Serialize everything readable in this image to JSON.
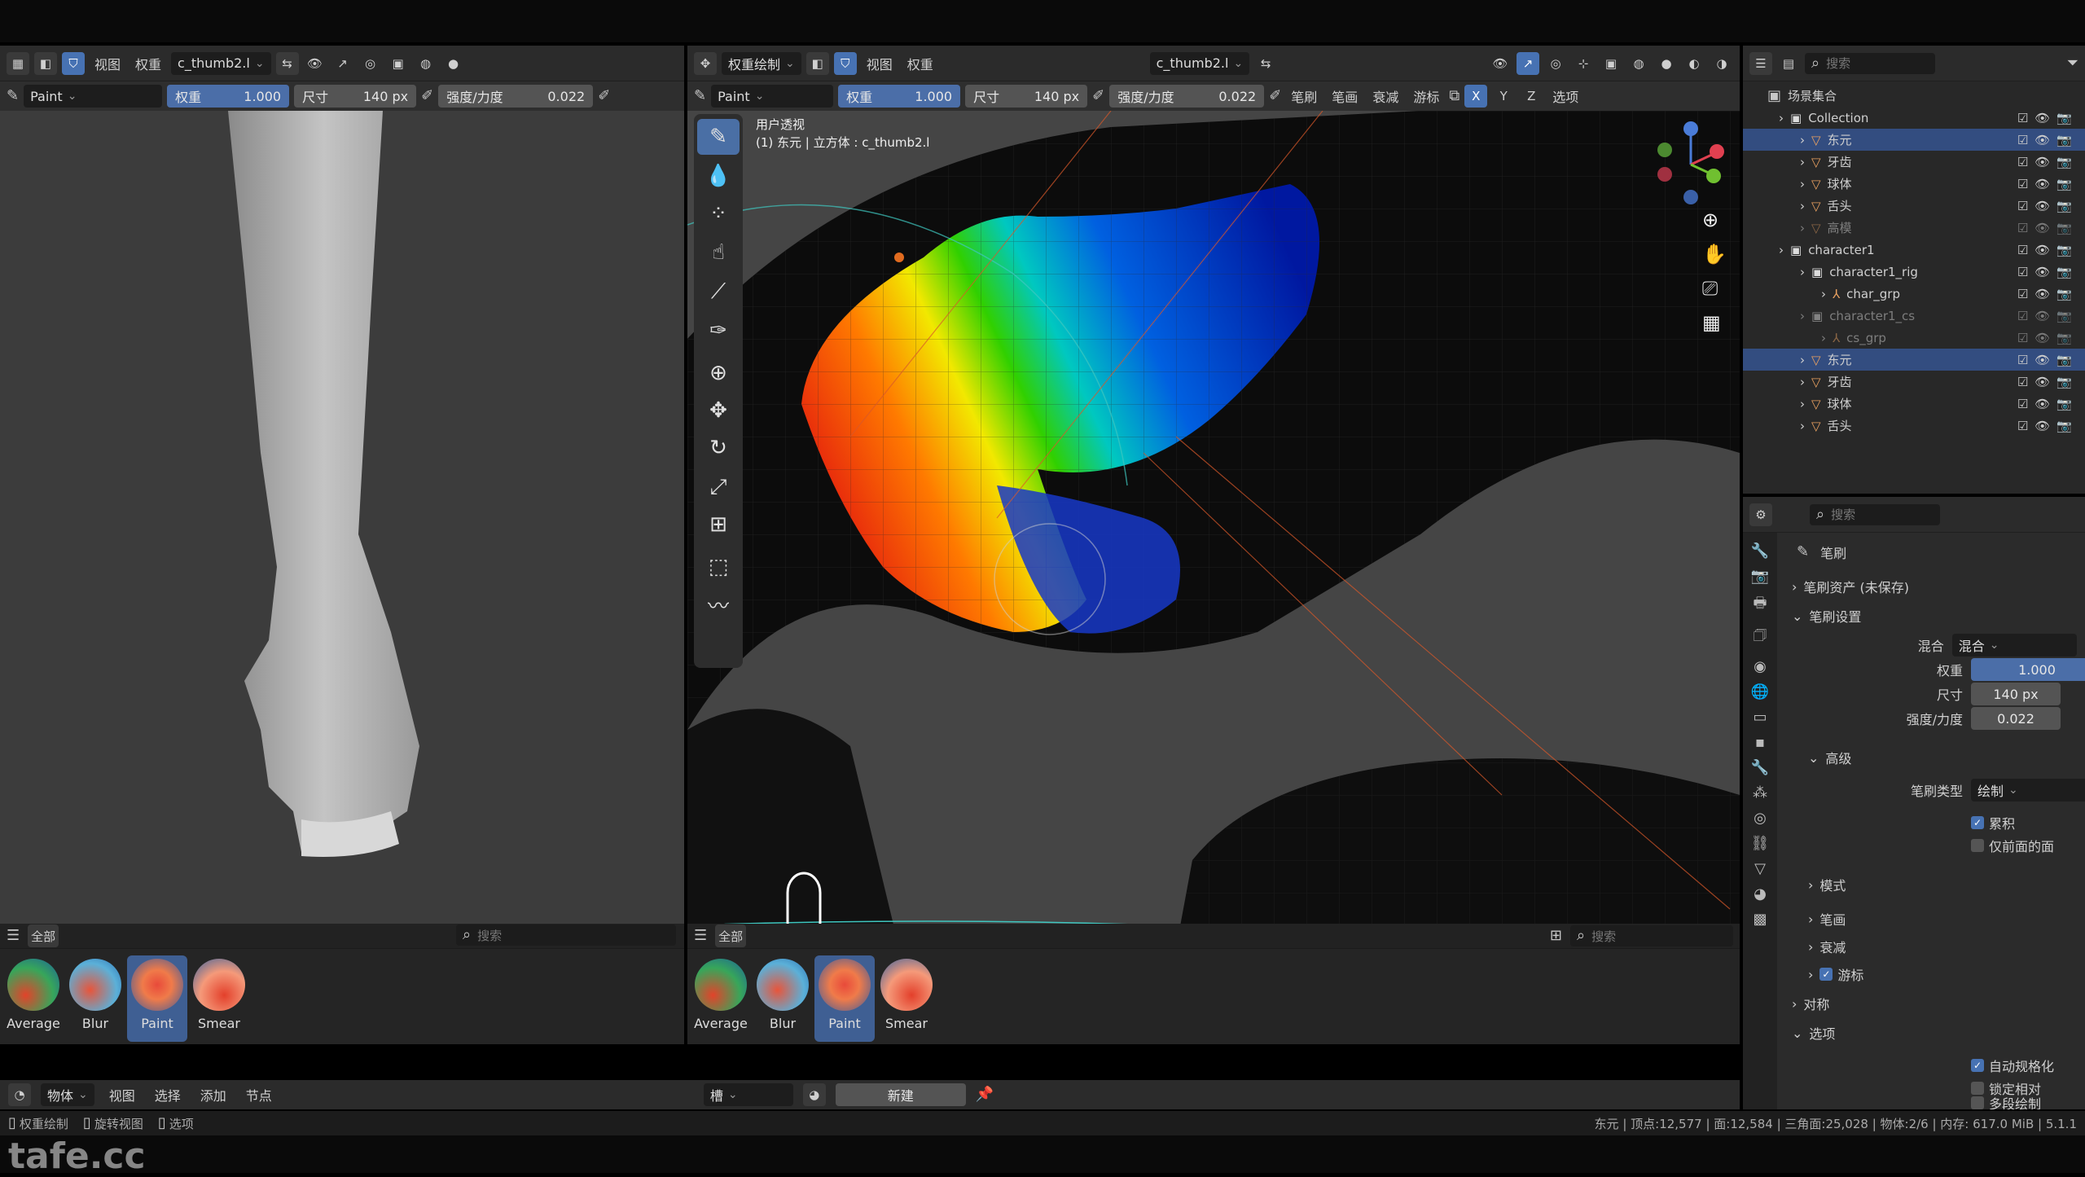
{
  "left_view": {
    "menu": [
      "视图",
      "权重"
    ],
    "object_name": "c_thumb2.l",
    "brush_name": "Paint",
    "weight_label": "权重",
    "weight_value": "1.000",
    "size_label": "尺寸",
    "size_value": "140 px",
    "strength_label": "强度/力度",
    "strength_value": "0.022",
    "shelf_tab": "全部",
    "search_placeholder": "搜索",
    "brushes": [
      "Average",
      "Blur",
      "Paint",
      "Smear"
    ]
  },
  "main_view": {
    "mode": "权重绘制",
    "menu": [
      "视图",
      "权重"
    ],
    "object_name": "c_thumb2.l",
    "brush_name": "Paint",
    "weight_label": "权重",
    "weight_value": "1.000",
    "size_label": "尺寸",
    "size_value": "140 px",
    "strength_label": "强度/力度",
    "strength_value": "0.022",
    "popovers": [
      "笔刷",
      "笔画",
      "衰减",
      "游标"
    ],
    "axis": [
      "X",
      "Y",
      "Z"
    ],
    "options": "选项",
    "overlay_line1": "用户透视",
    "overlay_line2": "(1) 东元 | 立方体 : c_thumb2.l",
    "shelf_tab": "全部",
    "search_placeholder": "搜索",
    "brushes": [
      "Average",
      "Blur",
      "Paint",
      "Smear"
    ]
  },
  "node_bar": {
    "menu": [
      "物体",
      "视图",
      "选择",
      "添加",
      "节点"
    ],
    "slot": "槽",
    "new_label": "新建"
  },
  "outliner": {
    "search_placeholder": "搜索",
    "root": "场景集合",
    "rows": [
      {
        "label": "Collection",
        "indent": 1,
        "type": "collection"
      },
      {
        "label": "东元",
        "indent": 2,
        "type": "mesh",
        "selected": true
      },
      {
        "label": "牙齿",
        "indent": 2,
        "type": "mesh"
      },
      {
        "label": "球体",
        "indent": 2,
        "type": "mesh"
      },
      {
        "label": "舌头",
        "indent": 2,
        "type": "mesh"
      },
      {
        "label": "高模",
        "indent": 2,
        "type": "mesh",
        "dim": true
      },
      {
        "label": "character1",
        "indent": 1,
        "type": "collection"
      },
      {
        "label": "character1_rig",
        "indent": 2,
        "type": "collection"
      },
      {
        "label": "char_grp",
        "indent": 3,
        "type": "armature"
      },
      {
        "label": "character1_cs",
        "indent": 2,
        "type": "collection",
        "dim": true
      },
      {
        "label": "cs_grp",
        "indent": 3,
        "type": "armature",
        "dim": true
      },
      {
        "label": "东元",
        "indent": 2,
        "type": "mesh",
        "selected": true
      },
      {
        "label": "牙齿",
        "indent": 2,
        "type": "mesh"
      },
      {
        "label": "球体",
        "indent": 2,
        "type": "mesh"
      },
      {
        "label": "舌头",
        "indent": 2,
        "type": "mesh"
      }
    ]
  },
  "properties": {
    "search_placeholder": "搜索",
    "title": "笔刷",
    "asset_section": "笔刷资产 (未保存)",
    "settings_section": "笔刷设置",
    "blend_label": "混合",
    "blend_value": "混合",
    "weight_label": "权重",
    "weight_value": "1.000",
    "size_label": "尺寸",
    "size_value": "140 px",
    "strength_label": "强度/力度",
    "strength_value": "0.022",
    "advanced_section": "高级",
    "brush_type_label": "笔刷类型",
    "brush_type_value": "绘制",
    "accumulate": "累积",
    "front_faces": "仅前面的面",
    "mode_section": "模式",
    "stroke_section": "笔画",
    "falloff_section": "衰减",
    "cursor_section": "游标",
    "symmetry_section": "对称",
    "options_section": "选项",
    "auto_normalize": "自动规格化",
    "lock_relative": "锁定相对",
    "multi_paint": "多段绘制"
  },
  "statusbar": {
    "left": [
      "权重绘制",
      "旋转视图",
      "选项"
    ],
    "right": "东元 | 顶点:12,577 | 面:12,584 | 三角面:25,028 | 物体:2/6 | 内存: 617.0 MiB | 5.1.1"
  },
  "watermark": "tafe.cc"
}
